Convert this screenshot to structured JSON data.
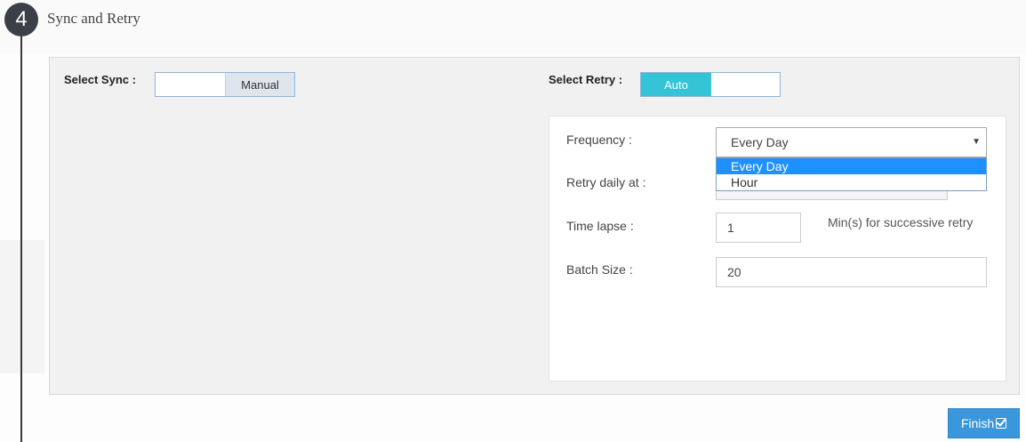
{
  "step": {
    "number": "4",
    "title": "Sync and Retry"
  },
  "sync": {
    "label": "Select Sync :",
    "option_manual": "Manual"
  },
  "retry": {
    "label": "Select Retry :",
    "option_auto": "Auto"
  },
  "form": {
    "frequency": {
      "label": "Frequency :",
      "selected": "Every Day",
      "options": [
        "Every Day",
        "Hour"
      ]
    },
    "retry_daily": {
      "label": "Retry daily at :",
      "value": ""
    },
    "time_lapse": {
      "label": "Time lapse :",
      "value": "1",
      "hint": "Min(s) for successive retry"
    },
    "batch_size": {
      "label": "Batch Size :",
      "value": "20"
    }
  },
  "actions": {
    "finish_label": "Finish"
  },
  "colors": {
    "accent": "#35c3d6",
    "button": "#3a97dc",
    "dropdown_highlight": "#1e90ff",
    "step_circle": "#3b3f47"
  }
}
